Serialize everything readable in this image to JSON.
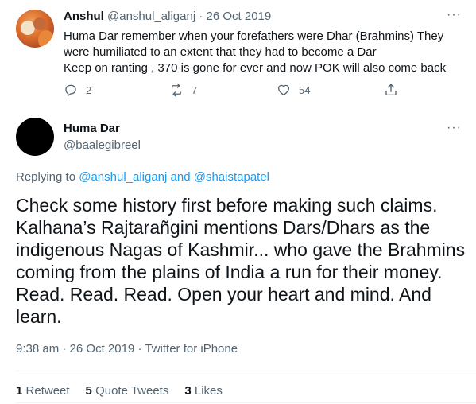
{
  "reply_tweet": {
    "author_name": "Anshul",
    "author_handle": "@anshul_aliganj",
    "separator": "·",
    "date": "26 Oct 2019",
    "lines": [
      "Huma Dar remember when your forefathers were Dhar (Brahmins) They",
      "were humiliated to an extent that they had to become a Dar",
      "Keep on ranting , 370 is gone for ever and now POK will also come back"
    ],
    "actions": {
      "replies": "2",
      "retweets": "7",
      "likes": "54",
      "icons": [
        "reply-icon",
        "retweet-icon",
        "like-icon",
        "share-icon"
      ]
    }
  },
  "main_tweet": {
    "author_name": "Huma Dar",
    "author_handle": "@baalegibreel",
    "replying_to_label": "Replying to",
    "replying_to_1": "@anshul_aliganj",
    "replying_and": "and",
    "replying_to_2": "@shaistapatel",
    "lines": [
      "Check some history first before making such claims.",
      "Kalhana’s Rajtarañgini mentions Dars/Dhars as the",
      "indigenous Nagas of Kashmir... who gave the Brahmins",
      "coming from the plains of India a run for their money.",
      "Read. Read. Read. Open your heart and mind. And",
      "learn."
    ],
    "time": "9:38 am",
    "separator": "·",
    "date": "26 Oct 2019",
    "source": "Twitter for iPhone",
    "stats": {
      "retweets_count": "1",
      "retweets_label": "Retweet",
      "quotes_count": "5",
      "quotes_label": "Quote Tweets",
      "likes_count": "3",
      "likes_label": "Likes"
    }
  },
  "more_label": "···",
  "colors": {
    "text": "#0f1419",
    "secondary": "#536471",
    "link": "#1d9bf0",
    "divider": "#eff3f4"
  }
}
